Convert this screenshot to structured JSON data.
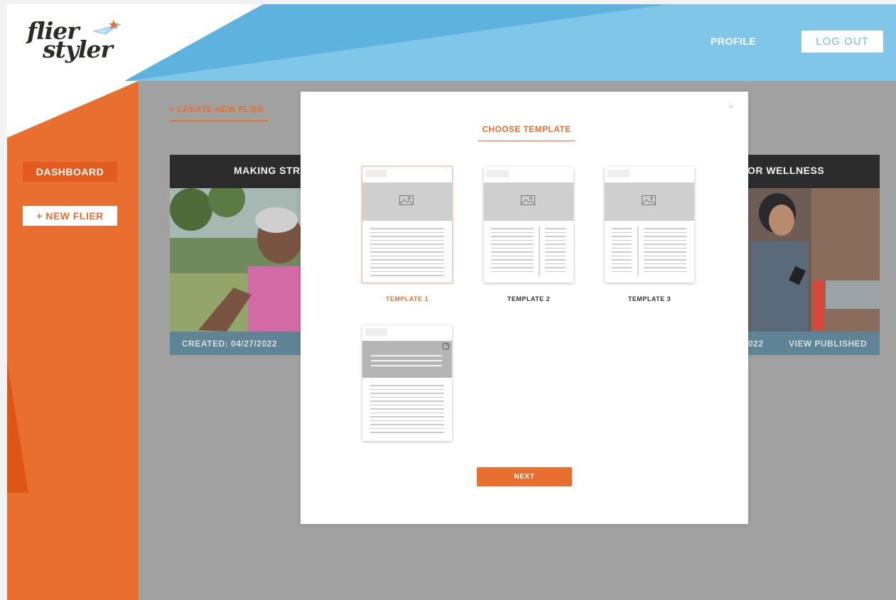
{
  "brand": {
    "logo_line1": "flier",
    "logo_line2": "styler",
    "trademark": "™"
  },
  "header": {
    "profile_label": "PROFILE",
    "logout_label": "LOG OUT"
  },
  "sidebar": {
    "dashboard_label": "DASHBOARD",
    "new_flier_label": "+ NEW FLIER"
  },
  "main": {
    "create_link": "+ CREATE NEW FLIER",
    "cards": [
      {
        "title": "MAKING STR",
        "created": "CREATED: 04/27/2022"
      },
      {
        "title": "OR WELLNESS",
        "created": "022",
        "action": "VIEW PUBLISHED"
      }
    ]
  },
  "modal": {
    "close_glyph": "×",
    "title": "CHOOSE TEMPLATE",
    "templates": [
      {
        "label": "TEMPLATE 1",
        "selected": true
      },
      {
        "label": "TEMPLATE 2",
        "selected": false
      },
      {
        "label": "TEMPLATE 3",
        "selected": false
      },
      {
        "label": "",
        "selected": false
      }
    ],
    "next_label": "NEXT"
  },
  "colors": {
    "accent_orange": "#e96f30",
    "dashboard_orange": "#e25b1f",
    "header_blue": "#5db3de",
    "header_light_blue": "#80c6e8",
    "overlay_gray": "#a1a1a1",
    "card_footer": "#5f8496"
  },
  "icons": [
    "paper-plane-icon",
    "image-placeholder-icon",
    "close-icon"
  ]
}
